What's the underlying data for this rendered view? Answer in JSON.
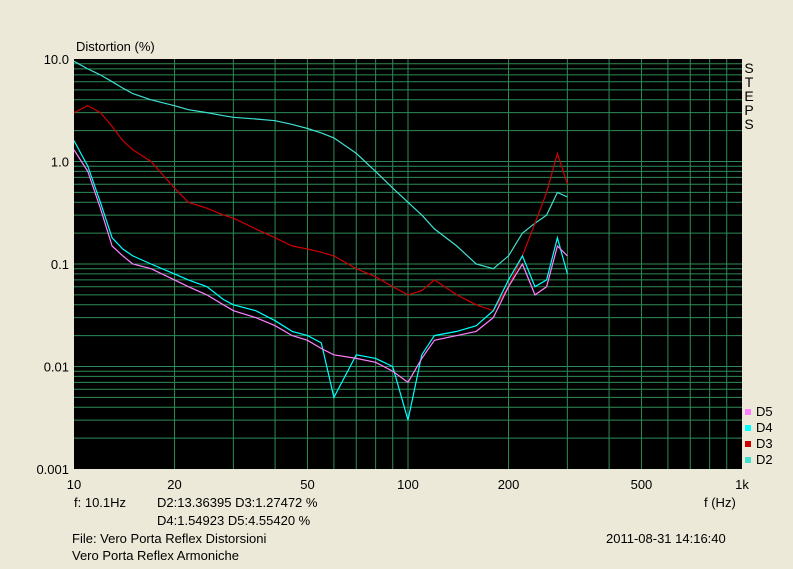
{
  "chart_data": {
    "type": "line",
    "ylabel": "Distortion (%)",
    "xlabel": "f (Hz)",
    "x_scale": "log",
    "y_scale": "log",
    "xlim": [
      10,
      1000
    ],
    "ylim": [
      0.001,
      10
    ],
    "x_ticks": [
      10,
      20,
      50,
      100,
      200,
      500,
      1000
    ],
    "x_tick_labels": [
      "10",
      "20",
      "50",
      "100",
      "200",
      "500",
      "1k"
    ],
    "y_ticks": [
      10,
      1,
      0.1,
      0.01,
      0.001
    ],
    "y_tick_labels": [
      "10.0",
      "1.0",
      "0.1",
      "0.01",
      "0.001"
    ],
    "grid": true,
    "legend_position": "bottom-right",
    "series": [
      {
        "name": "D5",
        "color": "#ff80ff",
        "x": [
          10,
          11,
          12,
          13,
          14,
          15,
          17,
          20,
          22,
          25,
          28,
          30,
          35,
          40,
          45,
          50,
          55,
          60,
          70,
          80,
          90,
          100,
          110,
          120,
          140,
          160,
          180,
          200,
          220,
          240,
          260,
          280,
          300
        ],
        "y": [
          1.3,
          0.8,
          0.35,
          0.15,
          0.12,
          0.1,
          0.09,
          0.07,
          0.06,
          0.05,
          0.04,
          0.035,
          0.03,
          0.025,
          0.02,
          0.018,
          0.015,
          0.013,
          0.012,
          0.011,
          0.009,
          0.007,
          0.012,
          0.018,
          0.02,
          0.022,
          0.03,
          0.06,
          0.1,
          0.05,
          0.06,
          0.15,
          0.12
        ]
      },
      {
        "name": "D4",
        "color": "#00ffff",
        "x": [
          10,
          11,
          12,
          13,
          14,
          15,
          17,
          20,
          22,
          25,
          28,
          30,
          35,
          40,
          45,
          50,
          55,
          60,
          70,
          80,
          90,
          100,
          110,
          120,
          140,
          160,
          180,
          200,
          220,
          240,
          260,
          280,
          300
        ],
        "y": [
          1.6,
          0.9,
          0.4,
          0.18,
          0.14,
          0.12,
          0.1,
          0.08,
          0.07,
          0.06,
          0.045,
          0.04,
          0.035,
          0.028,
          0.022,
          0.02,
          0.017,
          0.005,
          0.013,
          0.012,
          0.01,
          0.003,
          0.013,
          0.02,
          0.022,
          0.025,
          0.035,
          0.07,
          0.12,
          0.06,
          0.07,
          0.18,
          0.08
        ]
      },
      {
        "name": "D3",
        "color": "#cc0000",
        "x": [
          10,
          11,
          12,
          13,
          14,
          15,
          17,
          20,
          22,
          25,
          28,
          30,
          35,
          40,
          45,
          50,
          55,
          60,
          70,
          80,
          90,
          100,
          110,
          120,
          140,
          160,
          180,
          200,
          220,
          240,
          260,
          280,
          300
        ],
        "y": [
          3.0,
          3.5,
          3.0,
          2.2,
          1.6,
          1.3,
          1.0,
          0.55,
          0.4,
          0.35,
          0.3,
          0.28,
          0.22,
          0.18,
          0.15,
          0.14,
          0.13,
          0.12,
          0.09,
          0.075,
          0.06,
          0.05,
          0.055,
          0.07,
          0.05,
          0.04,
          0.035,
          0.06,
          0.12,
          0.25,
          0.5,
          1.2,
          0.6
        ]
      },
      {
        "name": "D2",
        "color": "#40e0d0",
        "x": [
          10,
          11,
          12,
          13,
          14,
          15,
          17,
          20,
          22,
          25,
          28,
          30,
          35,
          40,
          45,
          50,
          55,
          60,
          70,
          80,
          90,
          100,
          110,
          120,
          140,
          160,
          180,
          200,
          220,
          240,
          260,
          280,
          300
        ],
        "y": [
          9.5,
          8.0,
          7.0,
          6.0,
          5.2,
          4.6,
          4.0,
          3.5,
          3.2,
          3.0,
          2.8,
          2.7,
          2.6,
          2.5,
          2.3,
          2.1,
          1.9,
          1.7,
          1.2,
          0.8,
          0.55,
          0.4,
          0.3,
          0.22,
          0.15,
          0.1,
          0.09,
          0.12,
          0.2,
          0.25,
          0.3,
          0.5,
          0.45
        ]
      }
    ]
  },
  "steps_label": [
    "S",
    "T",
    "E",
    "P",
    "S"
  ],
  "readout": {
    "freq": "f: 10.1Hz",
    "line1": "D2:13.36395   D3:1.27472 %",
    "line2": "D4:1.54923   D5:4.55420   %"
  },
  "file_line1": "File: Vero Porta Reflex Distorsioni",
  "file_line2": "Vero Porta Reflex Armoniche",
  "timestamp": "2011-08-31 14:16:40"
}
